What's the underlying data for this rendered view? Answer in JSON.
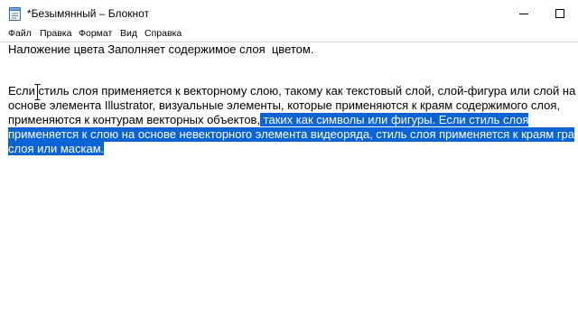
{
  "window": {
    "title": "*Безымянный – Блокнот",
    "app_icon": "notepad-icon",
    "controls": [
      "minimize-icon",
      "maximize-icon"
    ]
  },
  "menu": {
    "file": "Файл",
    "edit": "Правка",
    "format": "Формат",
    "view": "Вид",
    "help": "Справка"
  },
  "document": {
    "line1": "Наложение цвета Заполняет содержимое слоя  цветом.",
    "line2": "Если стиль слоя применяется к векторному слою, такому как текстовый слой, слой-фигура или слой на",
    "line3": "основе элемента Illustrator, визуальные элементы, которые применяются к краям содержимого слоя,",
    "line4a": "применяются к контурам векторных объектов,",
    "line4b": " таких как символы или фигуры. Если стиль слоя",
    "line5": "применяется к слою на основе невекторного элемента видеоряда, стиль слоя применяется к краям гра",
    "line6": "слоя или маскам."
  },
  "colors": {
    "selection": "#0a64d6"
  }
}
